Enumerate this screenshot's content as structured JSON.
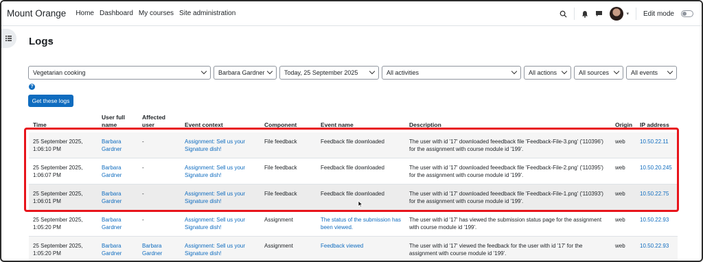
{
  "navbar": {
    "brand": "Mount Orange",
    "links": [
      "Home",
      "Dashboard",
      "My courses",
      "Site administration"
    ],
    "edit_mode_label": "Edit mode"
  },
  "page": {
    "heading": "Logs"
  },
  "filters": {
    "course": "Vegetarian cooking",
    "user": "Barbara Gardner",
    "date": "Today, 25 September 2025",
    "activity": "All activities",
    "actions": "All actions",
    "sources": "All sources",
    "events": "All events",
    "submit_label": "Get these logs"
  },
  "table": {
    "headers": {
      "time": "Time",
      "user_full_name": "User full name",
      "affected_user": "Affected user",
      "event_context": "Event context",
      "component": "Component",
      "event_name": "Event name",
      "description": "Description",
      "origin": "Origin",
      "ip_address": "IP address"
    },
    "rows": [
      {
        "time": "25 September 2025, 1:06:10 PM",
        "user": "Barbara Gardner",
        "affected": "-",
        "context": "Assignment: Sell us your Signature dish!",
        "component": "File feedback",
        "event": "Feedback file downloaded",
        "description": "The user with id '17' downloaded feeedback file 'Feedback-File-3.png' ('110396') for the assignment with course module id '199'.",
        "origin": "web",
        "ip": "10.50.22.11"
      },
      {
        "time": "25 September 2025, 1:06:07 PM",
        "user": "Barbara Gardner",
        "affected": "-",
        "context": "Assignment: Sell us your Signature dish!",
        "component": "File feedback",
        "event": "Feedback file downloaded",
        "description": "The user with id '17' downloaded feeedback file 'Feedback-File-2.png' ('110395') for the assignment with course module id '199'.",
        "origin": "web",
        "ip": "10.50.20.245"
      },
      {
        "time": "25 September 2025, 1:06:01 PM",
        "user": "Barbara Gardner",
        "affected": "-",
        "context": "Assignment: Sell us your Signature dish!",
        "component": "File feedback",
        "event": "Feedback file downloaded",
        "description": "The user with id '17' downloaded feeedback file 'Feedback-File-1.png' ('110393') for the assignment with course module id '199'.",
        "origin": "web",
        "ip": "10.50.22.75"
      },
      {
        "time": "25 September 2025, 1:05:20 PM",
        "user": "Barbara Gardner",
        "affected": "-",
        "context": "Assignment: Sell us your Signature dish!",
        "component": "Assignment",
        "event": "The status of the submission has been viewed.",
        "description": "The user with id '17' has viewed the submission status page for the assignment with course module id '199'.",
        "origin": "web",
        "ip": "10.50.22.93"
      },
      {
        "time": "25 September 2025, 1:05:20 PM",
        "user": "Barbara Gardner",
        "affected": "Barbara Gardner",
        "context": "Assignment: Sell us your Signature dish!",
        "component": "Assignment",
        "event": "Feedback viewed",
        "description": "The user with id '17' viewed the feedback for the user with id '17' for the assignment with course module id '199'.",
        "origin": "web",
        "ip": "10.50.22.93"
      }
    ]
  },
  "colors": {
    "link": "#0f6cbf",
    "primary": "#0f6cbf",
    "highlight": "#e8141b"
  }
}
